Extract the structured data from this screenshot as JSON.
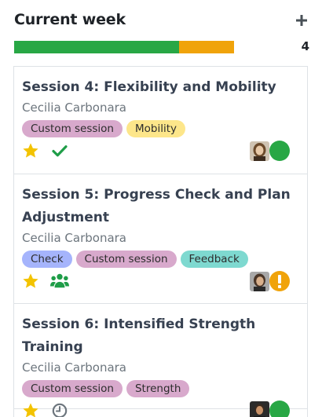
{
  "column": {
    "title": "Current week",
    "count": "4",
    "add_icon": "plus-icon",
    "progress": [
      {
        "status": "done",
        "fraction": 0.75,
        "color": "#28a745"
      },
      {
        "status": "warning",
        "fraction": 0.25,
        "color": "#f0a30a"
      }
    ]
  },
  "cards": [
    {
      "title": "Session 4: Flexibility and Mobility",
      "customer": "Cecilia Carbonara",
      "tags": [
        {
          "label": "Custom session",
          "color": "#d8a9cc"
        },
        {
          "label": "Mobility",
          "color": "#fde68a"
        }
      ],
      "starred": true,
      "activity_icon": "checkmark-icon",
      "state_icon": "state-green-circle-icon"
    },
    {
      "title": "Session 5: Progress Check and Plan Adjustment",
      "customer": "Cecilia Carbonara",
      "tags": [
        {
          "label": "Check",
          "color": "#a5b4fc"
        },
        {
          "label": "Custom session",
          "color": "#d8a9cc"
        },
        {
          "label": "Feedback",
          "color": "#7ed9d0"
        }
      ],
      "starred": true,
      "activity_icon": "users-icon",
      "state_icon": "state-warning-icon"
    },
    {
      "title": "Session 6: Intensified Strength Training",
      "customer": "Cecilia Carbonara",
      "tags": [
        {
          "label": "Custom session",
          "color": "#d8a9cc"
        },
        {
          "label": "Strength",
          "color": "#d8a9cc"
        }
      ],
      "starred": true,
      "activity_icon": "clock-icon",
      "state_icon": "state-green-circle-icon"
    }
  ],
  "colors": {
    "star": "#f3c300",
    "green": "#28a745",
    "warning": "#f0a30a",
    "activity_green": "#1f9d48",
    "clock_gray": "#6c757d"
  }
}
